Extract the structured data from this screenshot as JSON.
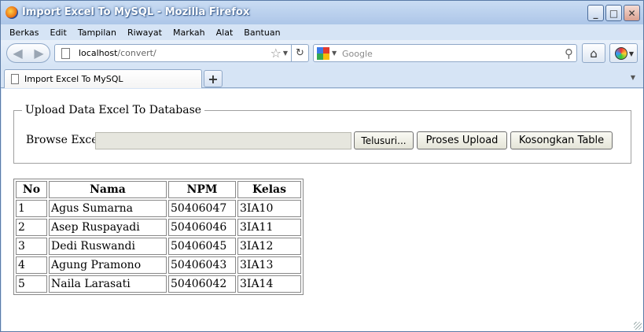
{
  "window": {
    "title": "Import Excel To MySQL - Mozilla Firefox"
  },
  "menubar": {
    "items": [
      "Berkas",
      "Edit",
      "Tampilan",
      "Riwayat",
      "Markah",
      "Alat",
      "Bantuan"
    ]
  },
  "navbar": {
    "url_host": "localhost",
    "url_path": "/convert/",
    "search_placeholder": "Google"
  },
  "tabs": [
    {
      "label": "Import Excel To MySQL"
    }
  ],
  "upload": {
    "legend": "Upload Data Excel To Database",
    "browse_label": "Browse Excel",
    "browse_button": "Telusuri...",
    "upload_button": "Proses Upload",
    "truncate_button": "Kosongkan Table"
  },
  "table": {
    "headers": [
      "No",
      "Nama",
      "NPM",
      "Kelas"
    ],
    "rows": [
      [
        "1",
        "Agus Sumarna",
        "50406047",
        "3IA10"
      ],
      [
        "2",
        "Asep Ruspayadi",
        "50406046",
        "3IA11"
      ],
      [
        "3",
        "Dedi Ruswandi",
        "50406045",
        "3IA12"
      ],
      [
        "4",
        "Agung Pramono",
        "50406043",
        "3IA13"
      ],
      [
        "5",
        "Naila Larasati",
        "50406042",
        "3IA14"
      ]
    ]
  }
}
